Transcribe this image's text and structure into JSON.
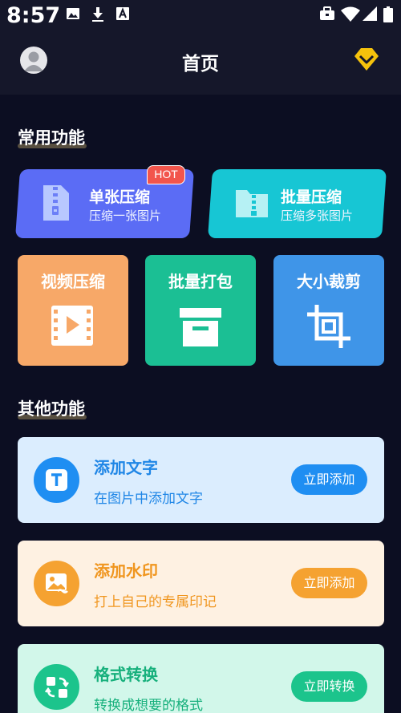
{
  "status_bar": {
    "time": "8:57",
    "left_icons": [
      "image-icon",
      "download-icon",
      "a-icon"
    ],
    "right_icons": [
      "briefcase-icon",
      "wifi-icon",
      "signal-icon",
      "battery-icon"
    ]
  },
  "header": {
    "title": "首页",
    "avatar_icon": "avatar-icon",
    "vip_icon": "vip-diamond-icon"
  },
  "common_section": {
    "title": "常用功能",
    "cards": [
      {
        "title": "单张压缩",
        "subtitle": "压缩一张图片",
        "badge": "HOT",
        "icon": "zip-file-icon",
        "color": "#5b6cf5"
      },
      {
        "title": "批量压缩",
        "subtitle": "压缩多张图片",
        "icon": "zip-folder-icon",
        "color": "#17c6d4"
      }
    ],
    "tiles": [
      {
        "title": "视频压缩",
        "icon": "video-icon",
        "color": "#f7a868"
      },
      {
        "title": "批量打包",
        "icon": "archive-box-icon",
        "color": "#1bbf94"
      },
      {
        "title": "大小裁剪",
        "icon": "crop-icon",
        "color": "#3f95e8"
      }
    ]
  },
  "other_section": {
    "title": "其他功能",
    "items": [
      {
        "title": "添加文字",
        "subtitle": "在图片中添加文字",
        "button": "立即添加",
        "icon": "text-icon",
        "bg": "#dbedfe",
        "accent": "#1f8ef2",
        "text_color": "#1f86e6"
      },
      {
        "title": "添加水印",
        "subtitle": "打上自己的专属印记",
        "button": "立即添加",
        "icon": "watermark-image-icon",
        "bg": "#fef1e2",
        "accent": "#f5a231",
        "text_color": "#f0961f"
      },
      {
        "title": "格式转换",
        "subtitle": "转换成想要的格式",
        "button": "立即转换",
        "icon": "convert-icon",
        "bg": "#d2f7ea",
        "accent": "#1cc48c",
        "text_color": "#17b07c"
      }
    ]
  }
}
